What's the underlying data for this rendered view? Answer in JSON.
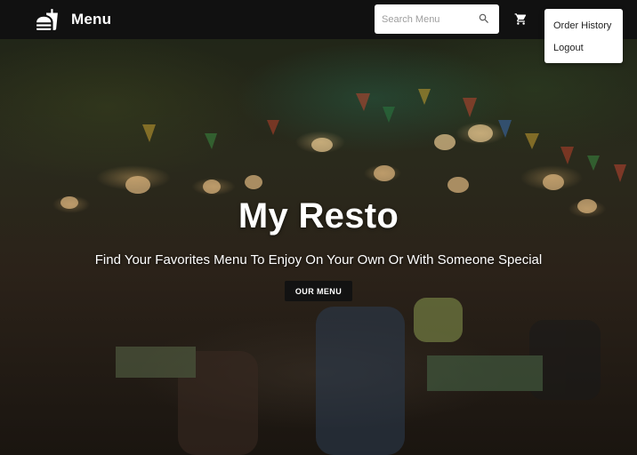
{
  "navbar": {
    "brand_title": "Menu",
    "brand_icon": "fastfood-icon",
    "search": {
      "placeholder": "Search Menu",
      "icon": "search-icon"
    },
    "cart_icon": "cart-icon",
    "background": "#111111"
  },
  "dropdown": {
    "items": [
      {
        "label": "Order History"
      },
      {
        "label": "Logout"
      }
    ]
  },
  "hero": {
    "title": "My Resto",
    "subtitle": "Find Your Favorites Menu To Enjoy On Your Own Or With Someone Special",
    "cta_label": "OUR MENU",
    "cta_color": "#121212"
  }
}
